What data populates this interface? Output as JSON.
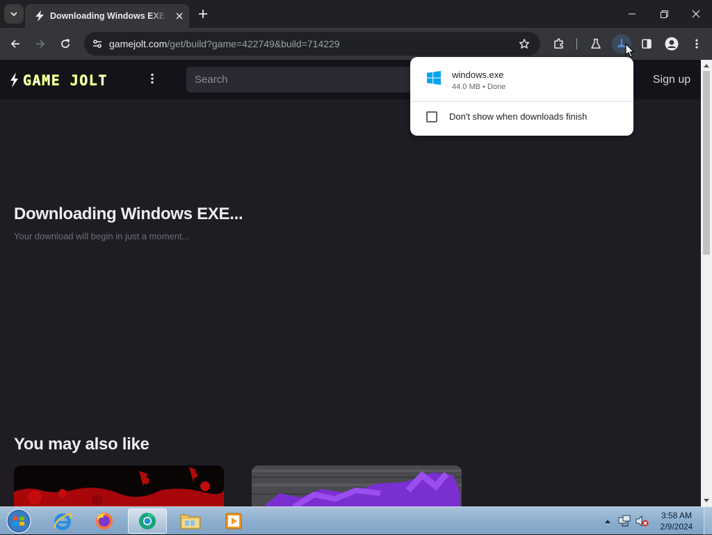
{
  "browser": {
    "tab": {
      "title": "Downloading Windows EXE - Game Jolt"
    },
    "omnibox": {
      "host": "gamejolt.com",
      "path": "/get/build?game=422749&build=714229"
    }
  },
  "site": {
    "logo_text": "GAME JOLT",
    "search_placeholder": "Search",
    "signup_label": "Sign up"
  },
  "page": {
    "heading": "Downloading Windows EXE...",
    "subtext": "Your download will begin in just a moment...",
    "also_heading": "You may also like"
  },
  "downloads_bubble": {
    "filename": "windows.exe",
    "status": "44.0 MB • Done",
    "checkbox_label": "Don't show when downloads finish",
    "checkbox_checked": false
  },
  "taskbar": {
    "time": "3:58 AM",
    "date": "2/9/2024"
  },
  "colors": {
    "page_bg": "#1f1d23",
    "header_bg": "#141319",
    "gj_green": "#ccff00",
    "windows_blue": "#00a4ef"
  }
}
